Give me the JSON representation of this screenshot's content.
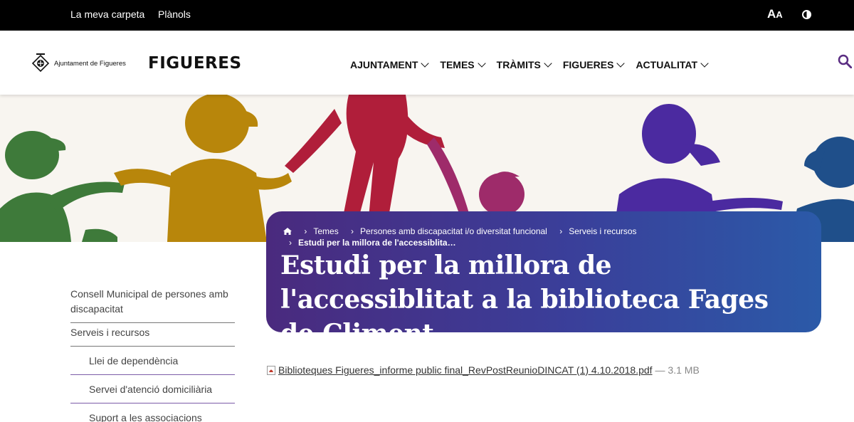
{
  "topbar": {
    "links": [
      "La meva carpeta",
      "Plànols"
    ],
    "font_toggle": "A",
    "font_toggle_small": "A"
  },
  "header": {
    "seal_text": "Ajuntament de Figueres",
    "brand": "FIGUERES",
    "nav": [
      "AJUNTAMENT",
      "TEMES",
      "TRÀMITS",
      "FIGUERES",
      "ACTUALITAT"
    ]
  },
  "breadcrumb": {
    "items": [
      "Temes",
      "Persones amb discapacitat i/o diversitat funcional",
      "Serveis i recursos"
    ],
    "current": "Estudi per la millora de l'accessiblita…"
  },
  "page": {
    "title": "Estudi per la millora de l'accessiblitat a la biblioteca Fages de Climent"
  },
  "sidebar": {
    "items": [
      {
        "label": "Consell Municipal de persones amb discapacitat",
        "sub": false
      },
      {
        "label": "Serveis i recursos",
        "sub": false
      },
      {
        "label": "Llei de dependència",
        "sub": true
      },
      {
        "label": "Servei d'atenció domiciliària",
        "sub": true
      },
      {
        "label": "Suport a les associacions",
        "sub": true
      }
    ]
  },
  "document": {
    "name": "Biblioteques Figueres_informe public final_RevPostReunioDINCAT (1) 4.10.2018.pdf",
    "size": "— 3.1 MB"
  },
  "colors": {
    "topbar": "#000000",
    "card_start": "#4a2a7e",
    "card_end": "#2b5aa8",
    "sidebar_rule": "#7c5ca8"
  }
}
